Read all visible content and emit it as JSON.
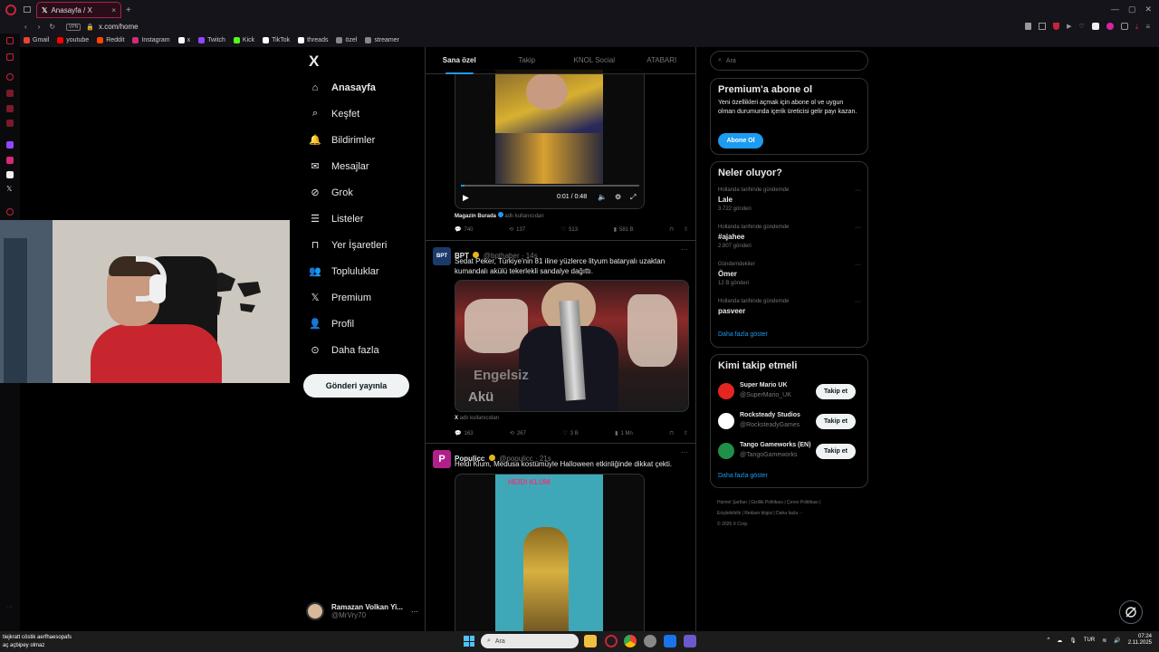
{
  "browser": {
    "tab_title": "Anasayfa / X",
    "url_badge": "VPN",
    "url": "x.com/home",
    "bookmarks": [
      {
        "label": "Gmail",
        "color": "#ea4335"
      },
      {
        "label": "youtube",
        "color": "#ff0000"
      },
      {
        "label": "Reddit",
        "color": "#ff4500"
      },
      {
        "label": "Instagram",
        "color": "#d62976"
      },
      {
        "label": "x",
        "color": "#ffffff"
      },
      {
        "label": "Twitch",
        "color": "#9146ff"
      },
      {
        "label": "Kick",
        "color": "#53fc18"
      },
      {
        "label": "TikTok",
        "color": "#ffffff"
      },
      {
        "label": "threads",
        "color": "#ffffff"
      },
      {
        "label": "özel",
        "color": "#888888"
      },
      {
        "label": "streamer",
        "color": "#888888"
      }
    ]
  },
  "nav": {
    "logo": "X",
    "items": [
      {
        "label": "Anasayfa",
        "icon": "home-icon"
      },
      {
        "label": "Keşfet",
        "icon": "search-icon"
      },
      {
        "label": "Bildirimler",
        "icon": "bell-icon"
      },
      {
        "label": "Mesajlar",
        "icon": "mail-icon"
      },
      {
        "label": "Grok",
        "icon": "grok-icon"
      },
      {
        "label": "Listeler",
        "icon": "list-icon"
      },
      {
        "label": "Yer İşaretleri",
        "icon": "bookmark-icon"
      },
      {
        "label": "Topluluklar",
        "icon": "people-icon"
      },
      {
        "label": "Premium",
        "icon": "x-icon"
      },
      {
        "label": "Profil",
        "icon": "person-icon"
      },
      {
        "label": "Daha fazla",
        "icon": "more-icon"
      }
    ],
    "post_button": "Gönderi yayınla",
    "account": {
      "name": "Ramazan Volkan Yi...",
      "handle": "@MrVry70"
    }
  },
  "feed": {
    "tabs": [
      "Sana özel",
      "Takip",
      "KNOL Social",
      "ATABARI"
    ],
    "tweet1": {
      "video_time": "0:01 / 0:48",
      "source": "Magazin Burada",
      "source_suffix": "adlı kullanıcıdan",
      "stats": {
        "replies": "740",
        "reposts": "137",
        "likes": "513",
        "views": "581 B"
      }
    },
    "tweet2": {
      "name": "BPT",
      "handle": "@bpthaber · 14s",
      "text": "Sedat Peker, Türkiye'nin 81 iline yüzlerce lityum bataryalı uzaktan kumandalı akülü tekerlekli sandalye dağıttı.",
      "image_text": "Akü",
      "image_text2": "Engelsiz",
      "source": "X",
      "source_suffix": "adlı kullanıcıdan",
      "stats": {
        "replies": "163",
        "reposts": "267",
        "likes": "3 B",
        "views": "1 Mn"
      }
    },
    "tweet3": {
      "name": "Populicc",
      "handle": "@populicc · 21s",
      "text": "Heidi Klum, Medusa kostümüyle Halloween etkinliğinde dikkat çekti.",
      "backdrop_text": "HEIDI KLUM"
    }
  },
  "sidebar": {
    "search_placeholder": "Ara",
    "premium": {
      "title": "Premium'a abone ol",
      "text": "Yeni özellikleri açmak için abone ol ve uygun olman durumunda içerik üreticisi gelir payı kazan.",
      "button": "Abone Ol"
    },
    "trends": {
      "title": "Neler oluyor?",
      "items": [
        {
          "meta": "Hollanda tarihinde gündemde",
          "name": "Lale",
          "count": "3.722 gönderi"
        },
        {
          "meta": "Hollanda tarihinde gündemde",
          "name": "#ajahee",
          "count": "2.807 gönderi"
        },
        {
          "meta": "Gündemdekiler",
          "name": "Ömer",
          "count": "12 B gönderi"
        },
        {
          "meta": "Hollanda tarihinde gündemde",
          "name": "pasveer",
          "count": ""
        }
      ],
      "more": "Daha fazla göster"
    },
    "who_to_follow": {
      "title": "Kimi takip etmeli",
      "items": [
        {
          "name": "Super Mario UK",
          "handle": "@SuperMario_UK",
          "button": "Takip et",
          "avatar_color": "#e52521"
        },
        {
          "name": "Rocksteady Studios",
          "handle": "@RocksteadyGames",
          "button": "Takip et",
          "avatar_color": "#ffffff"
        },
        {
          "name": "Tango Gameworks (EN)",
          "handle": "@TangoGameworks",
          "button": "Takip et",
          "avatar_color": "#1f8f4a"
        }
      ],
      "more": "Daha fazla göster"
    },
    "footer": {
      "line1": "Hizmet Şartları | Gizlilik Politikası | Çerez Politikası |",
      "line2": "Erişilebilirlik | Reklam bilgisi | Daha fazla ···",
      "line3": "© 2025 X Corp."
    }
  },
  "taskbar": {
    "search_placeholder": "Ara",
    "lang": "TUR",
    "time": "07:24",
    "date": "2.11.2025",
    "chat_line1": "tiejkratt cöstik aerfhaesopafs",
    "chat_line2": "aç açbipey olmaz"
  },
  "colors": {
    "accent": "#1d9bf0",
    "background": "#000000",
    "border": "#2f3336",
    "browser_accent": "#a8234a"
  }
}
